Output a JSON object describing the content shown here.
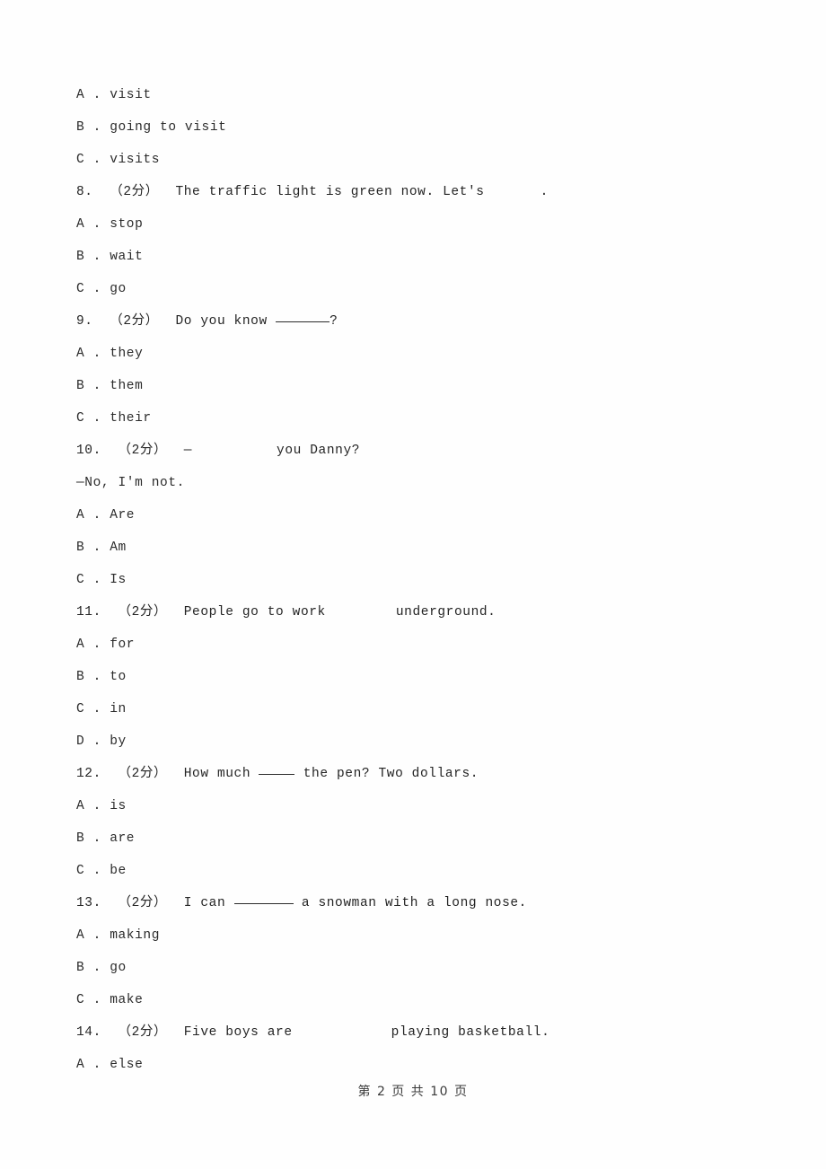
{
  "document": {
    "page_label": "第 2 页 共 10 页",
    "page_number": "2",
    "total_pages": "10"
  },
  "carryover_options": [
    {
      "label": "A . visit"
    },
    {
      "label": "B . going to visit"
    },
    {
      "label": "C . visits"
    }
  ],
  "questions": [
    {
      "number": "8.",
      "score": "（2分）",
      "stem_before": "The traffic light is green now. Let's",
      "blank_kind": "gap",
      "blank_width": 62,
      "stem_after": ".",
      "options": [
        {
          "label": "A . stop"
        },
        {
          "label": "B . wait"
        },
        {
          "label": "C . go"
        }
      ]
    },
    {
      "number": "9.",
      "score": "（2分）",
      "stem_before": "Do you know ",
      "blank_kind": "underline",
      "blank_width": 60,
      "stem_after": "?",
      "options": [
        {
          "label": "A . they"
        },
        {
          "label": "B . them"
        },
        {
          "label": "C . their"
        }
      ]
    },
    {
      "number": "10.",
      "score": "（2分）",
      "stem_before": "—",
      "blank_kind": "gap",
      "blank_width": 94,
      "stem_after": "you Danny?",
      "second_line": "—No, I'm not.",
      "options": [
        {
          "label": "A . Are"
        },
        {
          "label": "B . Am"
        },
        {
          "label": "C . Is"
        }
      ]
    },
    {
      "number": "11.",
      "score": "（2分）",
      "stem_before": "People go to work",
      "blank_kind": "gap",
      "blank_width": 78,
      "stem_after": "underground.",
      "options": [
        {
          "label": "A . for"
        },
        {
          "label": "B . to"
        },
        {
          "label": "C . in"
        },
        {
          "label": "D . by"
        }
      ]
    },
    {
      "number": "12.",
      "score": "（2分）",
      "stem_before": "How much ",
      "blank_kind": "underline",
      "blank_width": 40,
      "stem_after": " the pen? Two dollars.",
      "options": [
        {
          "label": "A . is"
        },
        {
          "label": "B . are"
        },
        {
          "label": "C . be"
        }
      ]
    },
    {
      "number": "13.",
      "score": "（2分）",
      "stem_before": "I can ",
      "blank_kind": "underline",
      "blank_width": 66,
      "stem_after": " a snowman with a long nose.",
      "options": [
        {
          "label": "A . making"
        },
        {
          "label": "B . go"
        },
        {
          "label": "C . make"
        }
      ]
    },
    {
      "number": "14.",
      "score": "（2分）",
      "stem_before": "Five boys are",
      "blank_kind": "gap",
      "blank_width": 110,
      "stem_after": "playing basketball.",
      "options": [
        {
          "label": "A . else"
        }
      ]
    }
  ]
}
